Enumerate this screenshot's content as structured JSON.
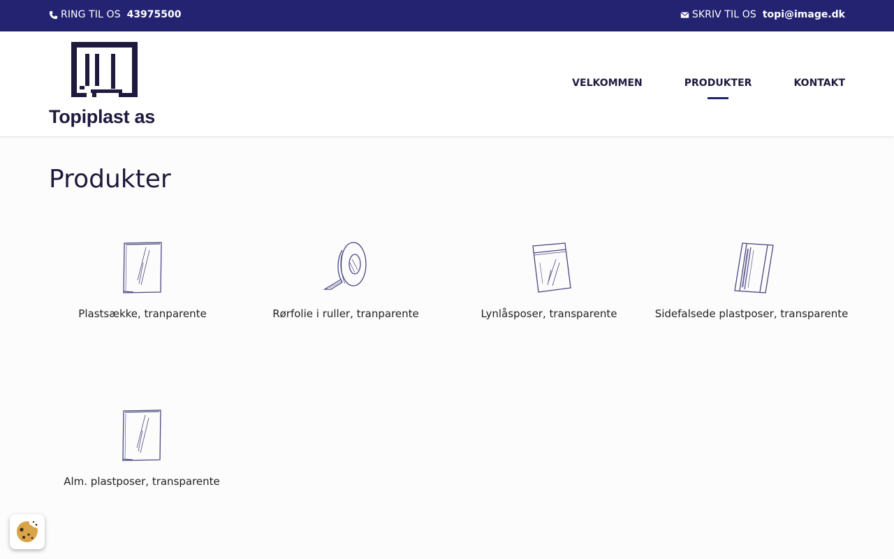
{
  "topbar": {
    "phone_label": "RING TIL OS",
    "phone_value": "43975500",
    "email_label": "SKRIV TIL OS",
    "email_value": "topi@image.dk"
  },
  "brand": {
    "name": "Topiplast as"
  },
  "nav": {
    "items": [
      {
        "label": "VELKOMMEN",
        "active": false
      },
      {
        "label": "PRODUKTER",
        "active": true
      },
      {
        "label": "KONTAKT",
        "active": false
      }
    ]
  },
  "page": {
    "title": "Produkter"
  },
  "products": [
    {
      "name": "Plastsække, tranparente",
      "icon": "plastic-bag-icon"
    },
    {
      "name": "Rørfolie i ruller, tranparente",
      "icon": "film-roll-icon"
    },
    {
      "name": "Lynlåsposer, transparente",
      "icon": "zip-bag-icon"
    },
    {
      "name": "Sidefalsede plastposer, transparente",
      "icon": "gusset-bag-icon"
    },
    {
      "name": "Alm. plastposer, transparente",
      "icon": "plastic-bag-icon"
    }
  ],
  "colors": {
    "primary": "#242372",
    "text": "#1f1a3d",
    "background": "#fcfcfc"
  },
  "cookie": {
    "icon": "cookie-icon"
  }
}
